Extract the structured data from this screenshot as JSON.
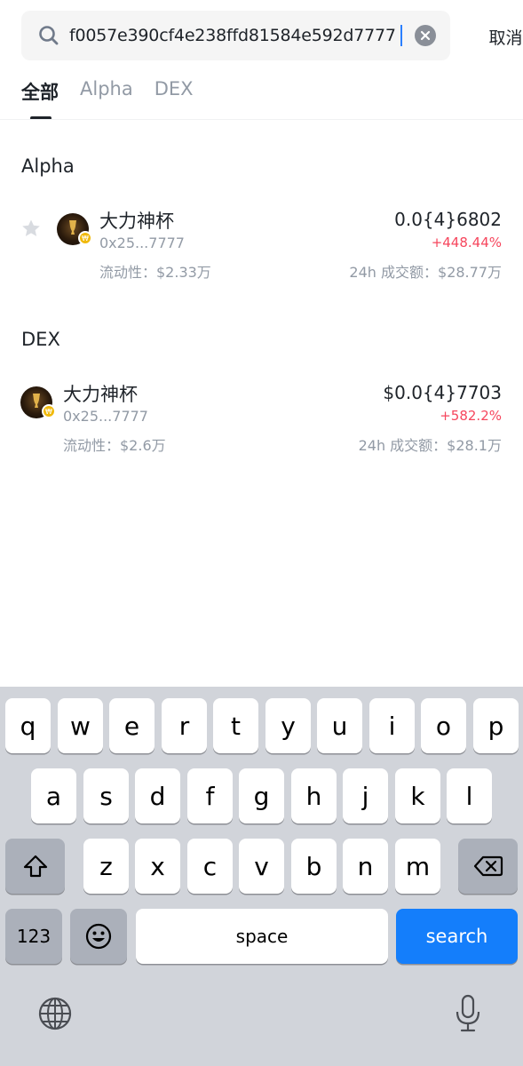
{
  "search": {
    "value": "f0057e390cf4e238ffd81584e592d7777",
    "cancel_label": "取消"
  },
  "tabs": [
    {
      "label": "全部",
      "active": true
    },
    {
      "label": "Alpha",
      "active": false
    },
    {
      "label": "DEX",
      "active": false
    }
  ],
  "sections": {
    "alpha": {
      "title": "Alpha",
      "item": {
        "name": "大力神杯",
        "address": "0x25...7777",
        "liquidity": "流动性：$2.33万",
        "price": "0.0{4}6802",
        "change": "+448.44%",
        "volume": "24h 成交额：$28.77万"
      }
    },
    "dex": {
      "title": "DEX",
      "item": {
        "name": "大力神杯",
        "address": "0x25...7777",
        "liquidity": "流动性：$2.6万",
        "price": "$0.0{4}7703",
        "change": "+582.2%",
        "volume": "24h 成交额：$28.1万"
      }
    }
  },
  "keyboard": {
    "row1": [
      "q",
      "w",
      "e",
      "r",
      "t",
      "y",
      "u",
      "i",
      "o",
      "p"
    ],
    "row2": [
      "a",
      "s",
      "d",
      "f",
      "g",
      "h",
      "j",
      "k",
      "l"
    ],
    "row3": [
      "z",
      "x",
      "c",
      "v",
      "b",
      "n",
      "m"
    ],
    "numbers_label": "123",
    "space_label": "space",
    "search_label": "search"
  },
  "colors": {
    "accent": "#147efb",
    "negative_change": "#f6465d",
    "badge": "#f0b90b"
  },
  "icons": [
    "search-icon",
    "clear-icon",
    "star-icon",
    "shift-icon",
    "backspace-icon",
    "emoji-icon",
    "globe-icon",
    "mic-icon"
  ]
}
